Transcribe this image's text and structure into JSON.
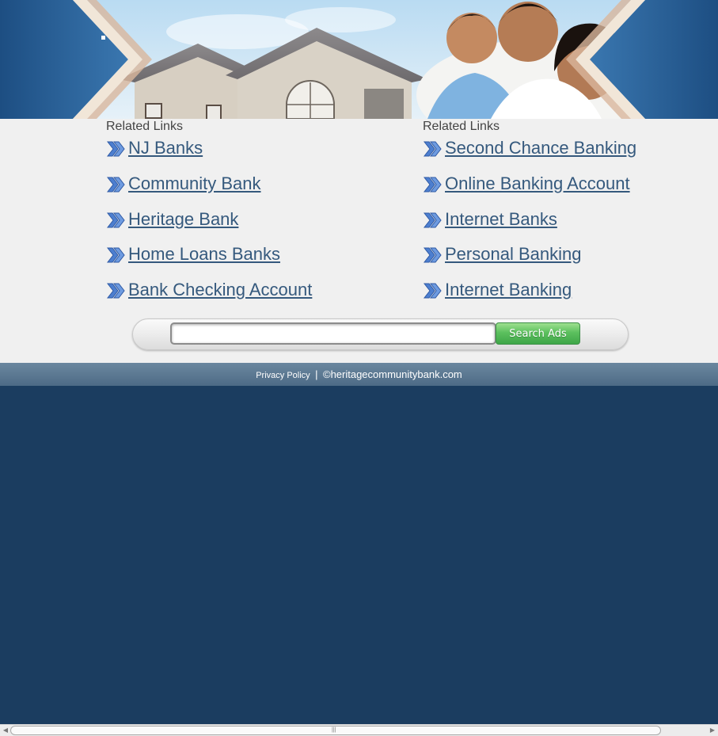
{
  "banner": {
    "image": "house-and-family-banner"
  },
  "links": {
    "left": {
      "heading": "Related Links",
      "items": [
        "NJ Banks",
        "Community Bank",
        "Heritage Bank",
        "Home Loans Banks",
        "Bank Checking Account"
      ]
    },
    "right": {
      "heading": "Related Links",
      "items": [
        "Second Chance Banking",
        "Online Banking Account",
        "Internet Banks",
        "Personal Banking",
        "Internet Banking"
      ]
    },
    "icon": "double-chevron-right-icon"
  },
  "search": {
    "value": "",
    "button_label": "Search Ads"
  },
  "footer": {
    "privacy_label": "Privacy Policy",
    "separator": "|",
    "copyright": "©heritagecommunitybank.com"
  },
  "colors": {
    "page_background": "#1b3d60",
    "content_background": "#f0f0f0",
    "link": "#35597d",
    "search_button": "#5cc05e",
    "footer": "#5a7791"
  }
}
